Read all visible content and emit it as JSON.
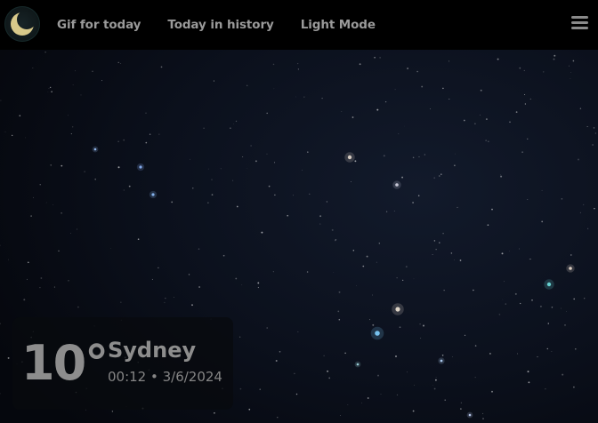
{
  "colors": {
    "navbar_background": "#000000",
    "sky_background": "#070a12",
    "nav_text": "#9a9a9a",
    "moon": "#d8c98a",
    "card_text": "#8d8d8d"
  },
  "navbar": {
    "logo_icon": "moon-icon",
    "links": [
      {
        "label": "Gif for today"
      },
      {
        "label": "Today in history"
      },
      {
        "label": "Light Mode"
      }
    ],
    "menu_icon": "hamburger-menu-icon"
  },
  "weather": {
    "temperature": "10°",
    "city": "Sydney",
    "datetime": "00:12 • 3/6/2024"
  }
}
